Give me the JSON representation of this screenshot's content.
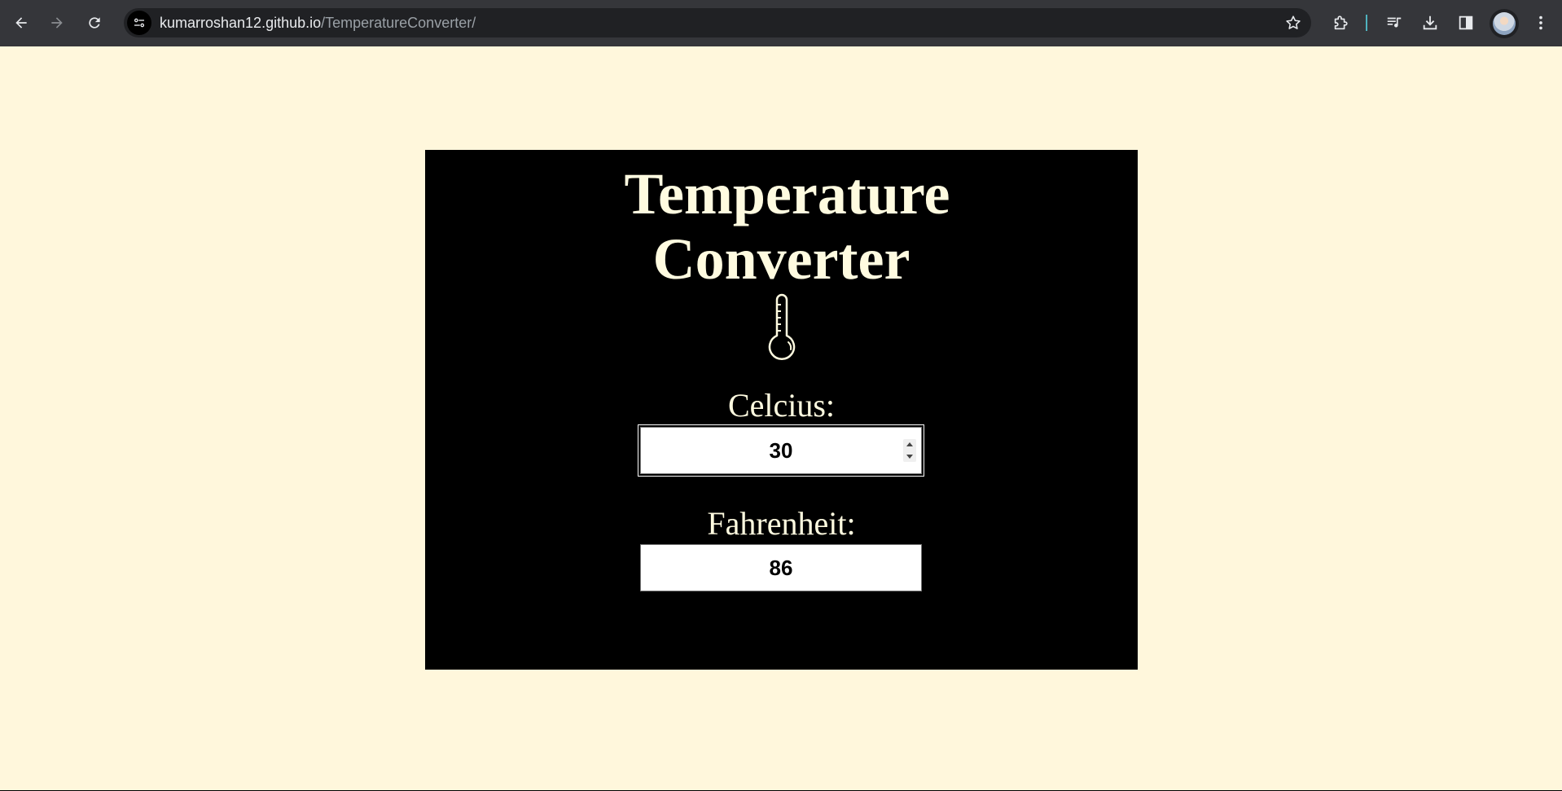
{
  "browser": {
    "url_host": "kumarroshan12.github.io",
    "url_path": "/TemperatureConverter/",
    "icons": {
      "back": "back-arrow-icon",
      "forward": "forward-arrow-icon",
      "reload": "reload-icon",
      "site_info": "site-info-icon",
      "bookmark": "star-icon",
      "extensions": "puzzle-icon",
      "media": "media-queue-icon",
      "downloads": "download-icon",
      "side_panel": "side-panel-icon",
      "profile": "avatar",
      "menu": "kebab-menu-icon"
    }
  },
  "app": {
    "title_line1": "Temperature",
    "title_line2": "Converter",
    "icon": "thermometer-icon",
    "celsius_label": "Celcius:",
    "celsius_value": "30",
    "fahrenheit_label": "Fahrenheit:",
    "fahrenheit_value": "86"
  },
  "colors": {
    "page_background": "#fff7dc",
    "card_background": "#000000",
    "text_color": "#fffbe0",
    "input_background": "#ffffff",
    "chrome_toolbar": "#35363a",
    "omnibox": "#202124"
  }
}
